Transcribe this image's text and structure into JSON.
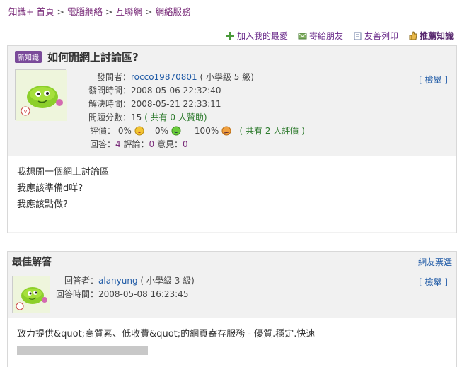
{
  "breadcrumb": [
    "知識+ 首頁",
    "電腦網絡",
    "互聯網",
    "網絡服務"
  ],
  "toolbar": {
    "add_fav": "加入我的最愛",
    "send_friend": "寄給朋友",
    "print": "友善列印",
    "recommend": "推薦知識"
  },
  "question": {
    "badge": "新知識",
    "title": "如何開網上討論區?",
    "asker_label": "發問者：",
    "asker": "rocco19870801",
    "asker_level": "( 小學級 5 級)",
    "ask_time_label": "發問時間：",
    "ask_time": "2008-05-06 22:32:40",
    "solve_time_label": "解決時間：",
    "solve_time": "2008-05-21 22:33:11",
    "score_label": "問題分數：",
    "score": "15",
    "support": "( 共有 0 人贊助)",
    "rating_label": "評價：",
    "rate_good": "0%",
    "rate_mid": "0%",
    "rate_bad": "100%",
    "rate_total": "( 共有 2 人評價 )",
    "answers_label": "回答：",
    "answers": "4",
    "comments_label": "評論：",
    "comments": "0",
    "opinions_label": "意見：",
    "opinions": "0",
    "report": "[ 檢舉 ]",
    "body_lines": [
      "我想開一個網上討論區",
      "我應該準備d咩?",
      "我應該點做?"
    ]
  },
  "best_answer": {
    "title": "最佳解答",
    "vote_link": "網友票選",
    "answerer_label": "回答者：",
    "answerer": "alanyung",
    "answerer_level": "( 小學級 3 級)",
    "answer_time_label": "回答時間：",
    "answer_time": "2008-05-08 16:23:45",
    "report": "[ 檢舉 ]",
    "body": "致力提供&quot;高質素、低收費&quot;的網頁寄存服務 - 優質.穩定.快速"
  },
  "colors": {
    "accent": "#7a2d7a",
    "link": "#1f5aa6",
    "panel": "#f1f1f1"
  }
}
